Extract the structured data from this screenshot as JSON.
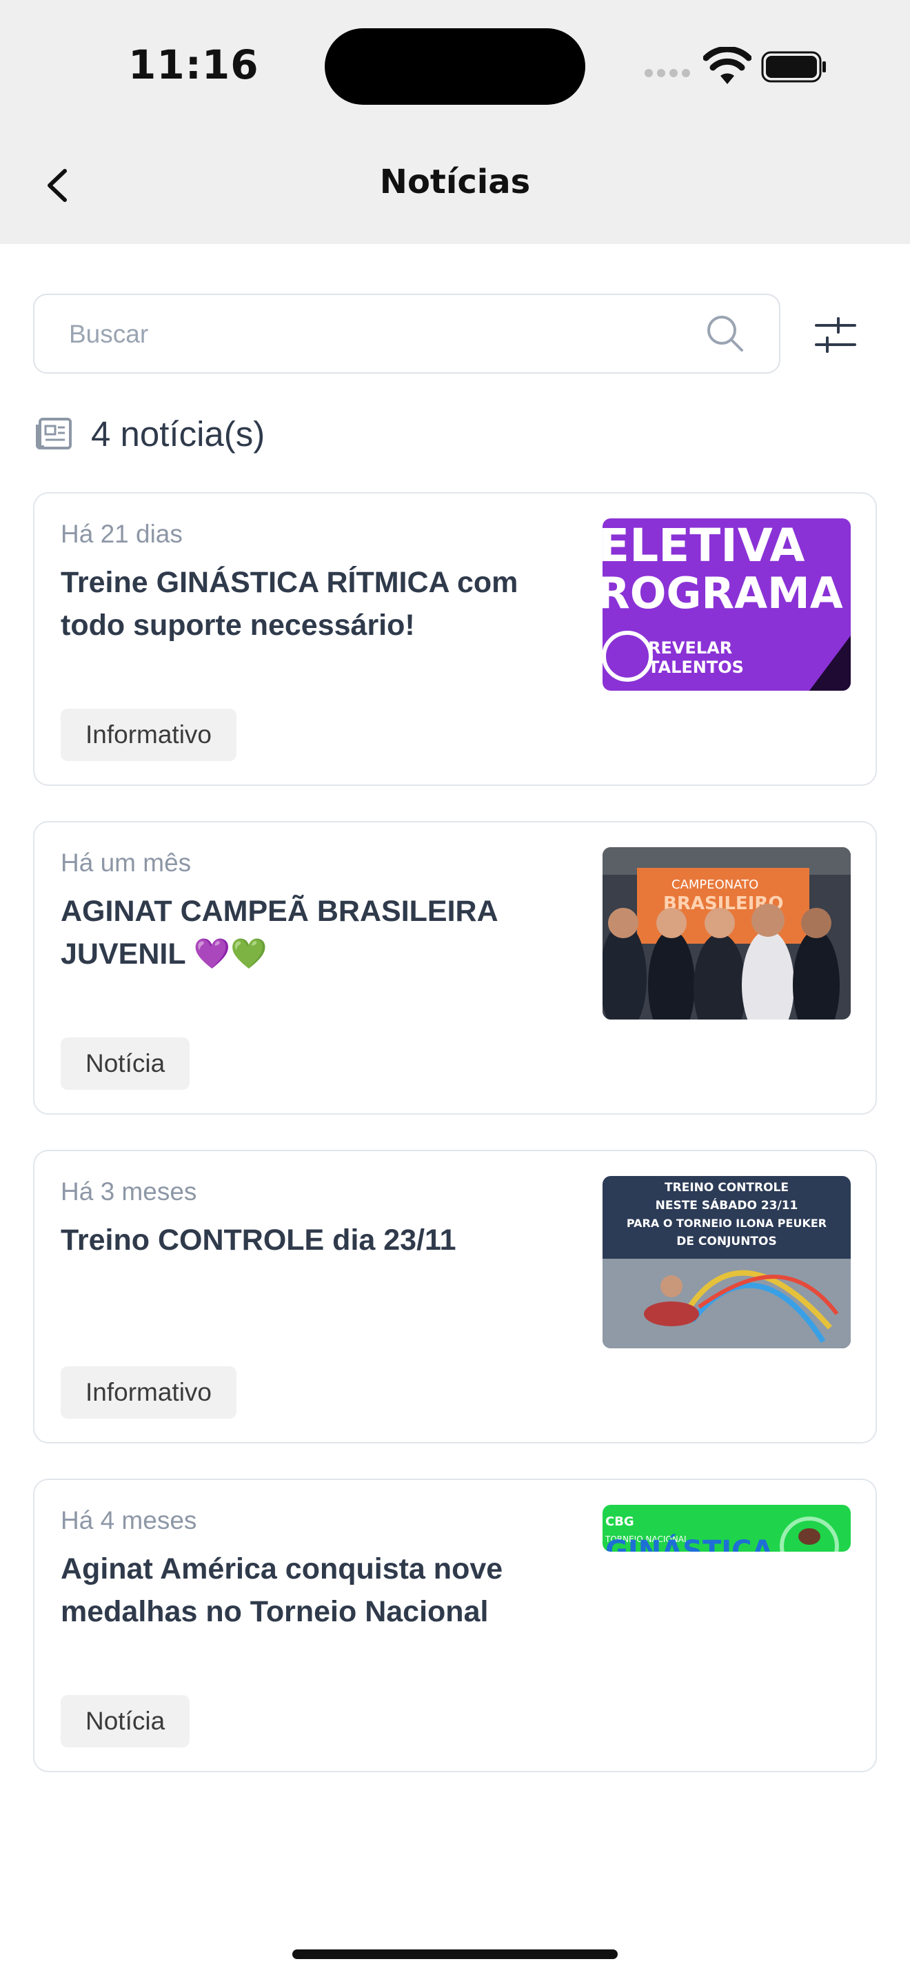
{
  "status_bar": {
    "time": "11:16"
  },
  "header": {
    "title": "Notícias"
  },
  "search": {
    "placeholder": "Buscar",
    "value": ""
  },
  "results": {
    "count_label": "4 notícia(s)"
  },
  "news": [
    {
      "date": "Há 21 dias",
      "title": "Treine GINÁSTICA RÍTMICA com todo suporte necessário!",
      "tag": "Informativo",
      "thumb_lines": [
        "ELETIVA",
        "ROGRAMA",
        "REVELAR",
        "TALENTOS"
      ]
    },
    {
      "date": "Há um mês",
      "title": "AGINAT CAMPEÃ BRASILEIRA JUVENIL 💜💚",
      "tag": "Notícia",
      "thumb_lines": [
        "CAMPEONATO",
        "BRASILEIRO"
      ]
    },
    {
      "date": "Há 3 meses",
      "title": "Treino CONTROLE dia 23/11",
      "tag": "Informativo",
      "thumb_lines": [
        "TREINO CONTROLE",
        "NESTE SÁBADO 23/11",
        "PARA O TORNEIO ILONA PEUKER",
        "DE CONJUNTOS"
      ]
    },
    {
      "date": "Há 4 meses",
      "title": "Aginat América conquista nove medalhas no Torneio Nacional",
      "tag": "Notícia",
      "thumb_lines": [
        "CBG",
        "TORNEIO NACIONAL",
        "GINÁSTICA"
      ]
    }
  ]
}
